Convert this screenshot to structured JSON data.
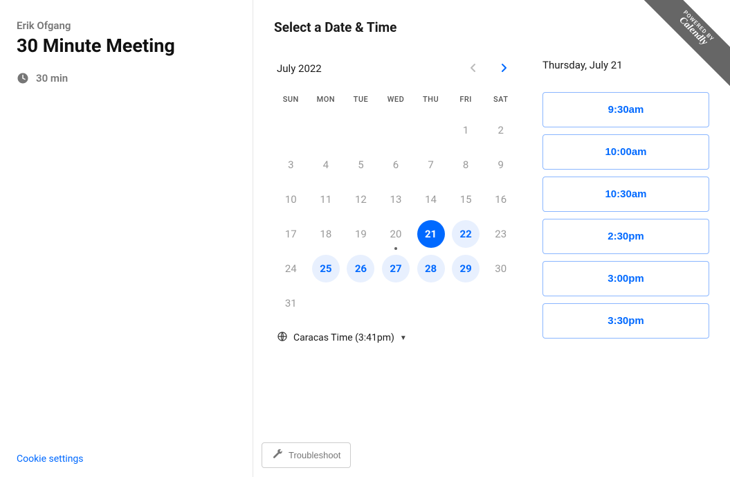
{
  "sidebar": {
    "host_name": "Erik Ofgang",
    "meeting_title": "30 Minute Meeting",
    "duration_label": "30 min",
    "cookie_settings_label": "Cookie settings"
  },
  "main": {
    "header": "Select a Date & Time",
    "month_label": "July 2022",
    "dow": [
      "SUN",
      "MON",
      "TUE",
      "WED",
      "THU",
      "FRI",
      "SAT"
    ],
    "weeks": [
      [
        {
          "d": ""
        },
        {
          "d": ""
        },
        {
          "d": ""
        },
        {
          "d": ""
        },
        {
          "d": ""
        },
        {
          "d": "1"
        },
        {
          "d": "2"
        }
      ],
      [
        {
          "d": "3"
        },
        {
          "d": "4"
        },
        {
          "d": "5"
        },
        {
          "d": "6"
        },
        {
          "d": "7"
        },
        {
          "d": "8"
        },
        {
          "d": "9"
        }
      ],
      [
        {
          "d": "10"
        },
        {
          "d": "11"
        },
        {
          "d": "12"
        },
        {
          "d": "13"
        },
        {
          "d": "14"
        },
        {
          "d": "15"
        },
        {
          "d": "16"
        }
      ],
      [
        {
          "d": "17"
        },
        {
          "d": "18"
        },
        {
          "d": "19"
        },
        {
          "d": "20",
          "today": true
        },
        {
          "d": "21",
          "selected": true
        },
        {
          "d": "22",
          "available": true
        },
        {
          "d": "23"
        }
      ],
      [
        {
          "d": "24"
        },
        {
          "d": "25",
          "available": true
        },
        {
          "d": "26",
          "available": true
        },
        {
          "d": "27",
          "available": true
        },
        {
          "d": "28",
          "available": true
        },
        {
          "d": "29",
          "available": true
        },
        {
          "d": "30"
        }
      ],
      [
        {
          "d": "31"
        },
        {
          "d": ""
        },
        {
          "d": ""
        },
        {
          "d": ""
        },
        {
          "d": ""
        },
        {
          "d": ""
        },
        {
          "d": ""
        }
      ]
    ],
    "timezone_label": "Caracas Time (3:41pm)",
    "selected_date_label": "Thursday, July 21",
    "slots": [
      "9:30am",
      "10:00am",
      "10:30am",
      "2:30pm",
      "3:00pm",
      "3:30pm"
    ],
    "troubleshoot_label": "Troubleshoot"
  },
  "badge": {
    "powered_by": "POWERED BY",
    "brand": "Calendly"
  }
}
